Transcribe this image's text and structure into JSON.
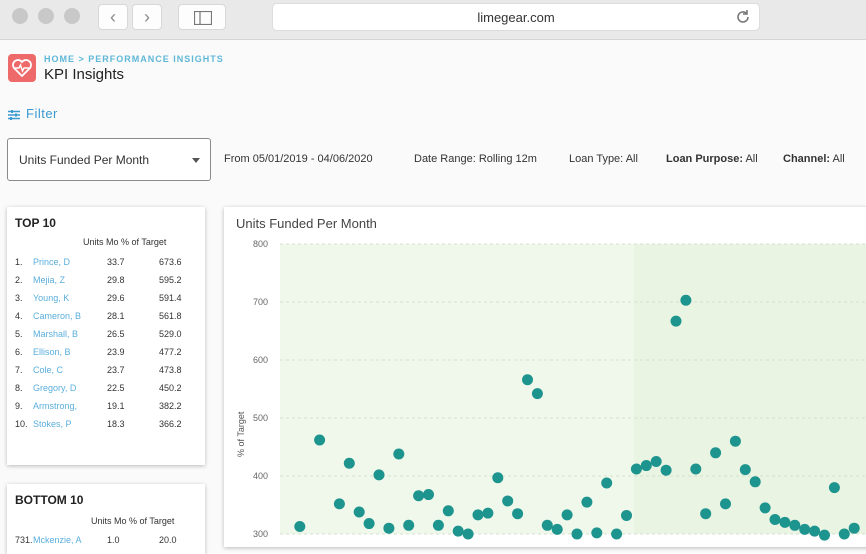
{
  "browser": {
    "url": "limegear.com",
    "back_glyph": "‹",
    "forward_glyph": "›"
  },
  "header": {
    "breadcrumb": "HOME > PERFORMANCE INSIGHTS",
    "title": "KPI Insights",
    "filter_label": "Filter",
    "logo_color": "#ee6a6a",
    "accent": "#3a9bd0"
  },
  "filters": {
    "metric": "Units Funded Per Month",
    "from": "From 05/01/2019 - 04/06/2020",
    "date_range_label": "Date Range:",
    "date_range_value": "Rolling 12m",
    "loan_type_label": "Loan Type:",
    "loan_type_value": "All",
    "loan_purpose_label": "Loan Purpose:",
    "loan_purpose_value": "All",
    "channel_label": "Channel:",
    "channel_value": "All"
  },
  "top10": {
    "title": "TOP 10",
    "col_units": "Units Mo",
    "col_pct": "% of Target",
    "rows": [
      {
        "rank": "1.",
        "name": "Prince, D",
        "units": "33.7",
        "pct": "673.6"
      },
      {
        "rank": "2.",
        "name": "Mejia, Z",
        "units": "29.8",
        "pct": "595.2"
      },
      {
        "rank": "3.",
        "name": "Young, K",
        "units": "29.6",
        "pct": "591.4"
      },
      {
        "rank": "4.",
        "name": "Cameron, B",
        "units": "28.1",
        "pct": "561.8"
      },
      {
        "rank": "5.",
        "name": "Marshall, B",
        "units": "26.5",
        "pct": "529.0"
      },
      {
        "rank": "6.",
        "name": "Ellison, B",
        "units": "23.9",
        "pct": "477.2"
      },
      {
        "rank": "7.",
        "name": "Cole, C",
        "units": "23.7",
        "pct": "473.8"
      },
      {
        "rank": "8.",
        "name": "Gregory, D",
        "units": "22.5",
        "pct": "450.2"
      },
      {
        "rank": "9.",
        "name": "Armstrong,",
        "units": "19.1",
        "pct": "382.2"
      },
      {
        "rank": "10.",
        "name": "Stokes, P",
        "units": "18.3",
        "pct": "366.2"
      }
    ]
  },
  "bottom10": {
    "title": "BOTTOM 10",
    "col_units": "Units Mo",
    "col_pct": "% of Target",
    "rows": [
      {
        "rank": "731.",
        "name": "Mckenzie, A",
        "units": "1.0",
        "pct": "20.0"
      }
    ]
  },
  "chart_data": {
    "type": "scatter",
    "title": "Units Funded Per Month",
    "ylabel": "% of Target",
    "yticks": [
      "800",
      "700",
      "600",
      "500",
      "400",
      "300"
    ],
    "ylim": [
      300,
      800
    ],
    "grid": true,
    "point_color": "#1e948e",
    "x": [
      1,
      2,
      3,
      3.5,
      4,
      4.5,
      5,
      5.5,
      6,
      6.5,
      7,
      7.5,
      8,
      8.5,
      9,
      9.5,
      10,
      10.5,
      11,
      11.5,
      12,
      12.5,
      13,
      13.5,
      14,
      14.5,
      15,
      15.5,
      16,
      16.5,
      17,
      17.5,
      18,
      18.5,
      19,
      19.5,
      20,
      20.5,
      21,
      21.5,
      22,
      22.5,
      23,
      23.5,
      24,
      24.5,
      25,
      25.5,
      26,
      26.5,
      27,
      27.5,
      28,
      28.5,
      29
    ],
    "y": [
      313,
      462,
      352,
      422,
      338,
      318,
      402,
      310,
      438,
      315,
      366,
      368,
      315,
      340,
      305,
      300,
      333,
      336,
      397,
      357,
      335,
      566,
      542,
      315,
      308,
      333,
      300,
      355,
      302,
      388,
      300,
      332,
      412,
      418,
      425,
      410,
      667,
      703,
      412,
      335,
      440,
      352,
      460,
      411,
      390,
      345,
      325,
      320,
      315,
      308,
      305,
      298,
      380,
      300,
      310
    ],
    "xlim": [
      0,
      30
    ]
  }
}
